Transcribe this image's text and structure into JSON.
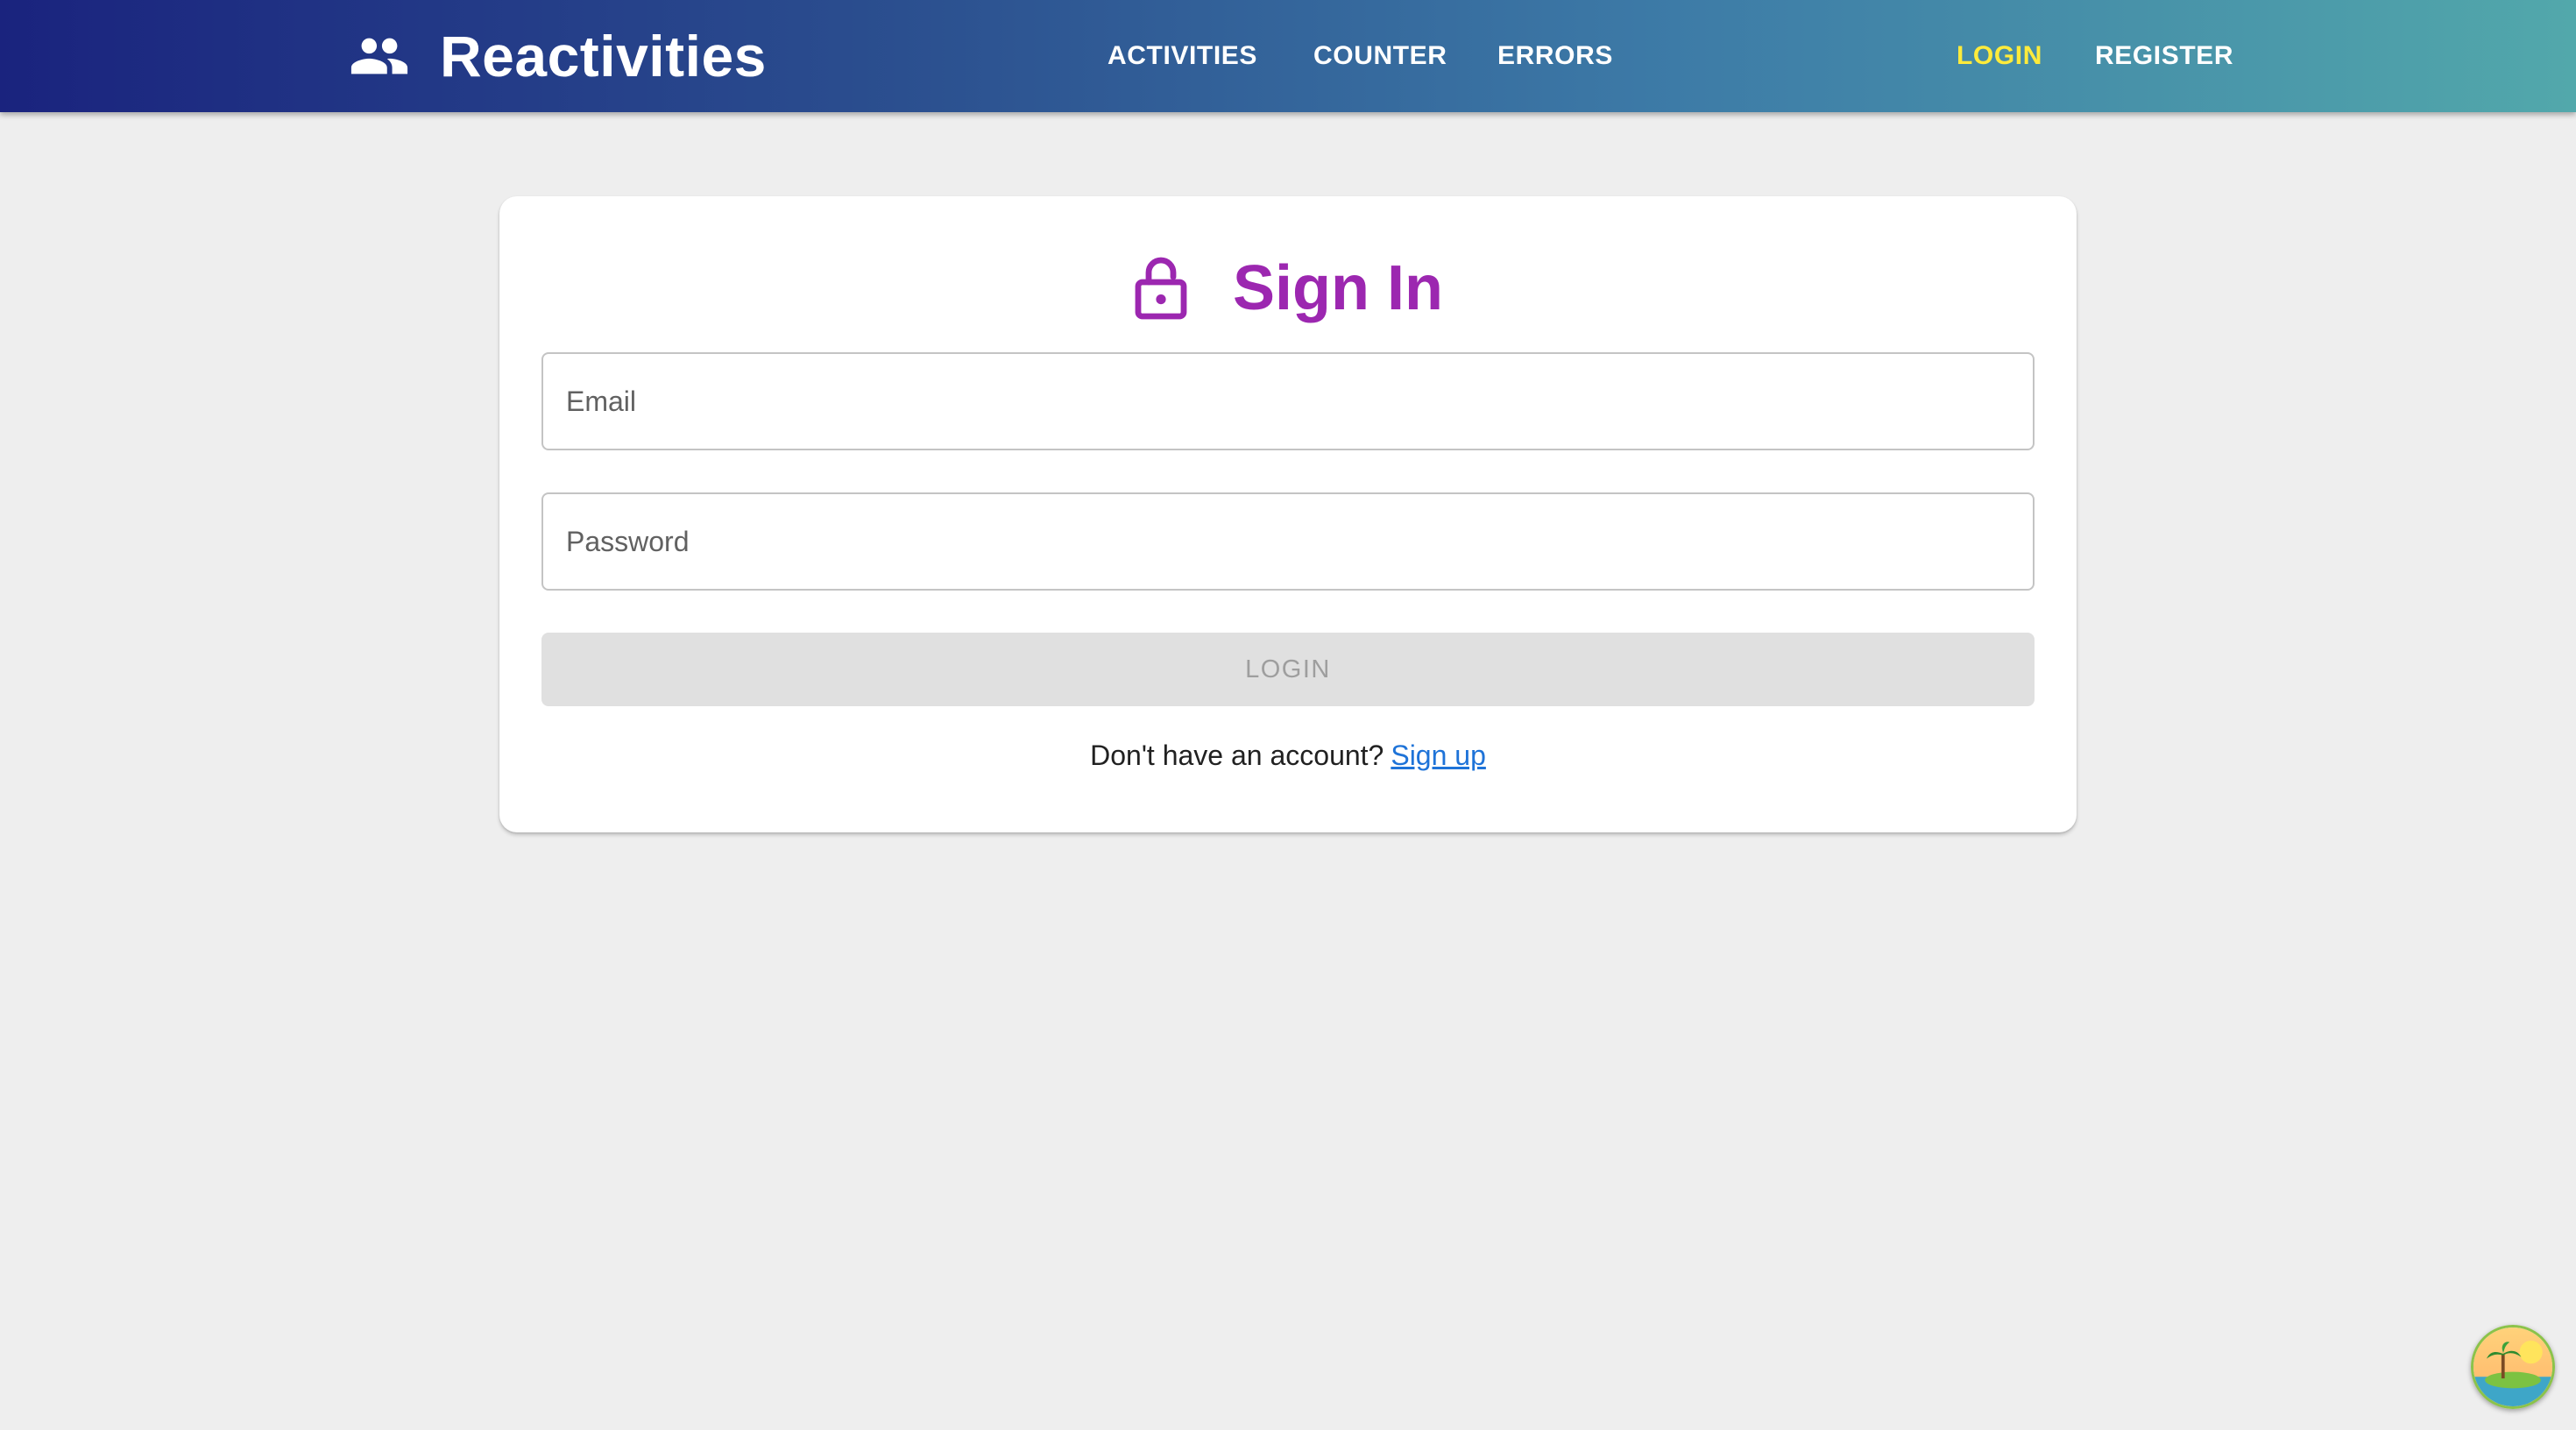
{
  "header": {
    "brand_title": "Reactivities",
    "brand_icon": "people-icon",
    "nav": [
      {
        "label": "ACTIVITIES"
      },
      {
        "label": "COUNTER"
      },
      {
        "label": "ERRORS"
      }
    ],
    "auth": [
      {
        "label": "LOGIN",
        "active": true
      },
      {
        "label": "REGISTER",
        "active": false
      }
    ],
    "active_color": "#ffeb3b"
  },
  "signin": {
    "title": "Sign In",
    "icon": "lock-open-icon",
    "email_placeholder": "Email",
    "password_placeholder": "Password",
    "submit_label": "LOGIN",
    "submit_disabled": true,
    "footer_text": "Don't have an account?",
    "signup_link": "Sign up",
    "accent_color": "#9c27b0"
  },
  "badge": {
    "icon": "island-avatar-icon"
  }
}
